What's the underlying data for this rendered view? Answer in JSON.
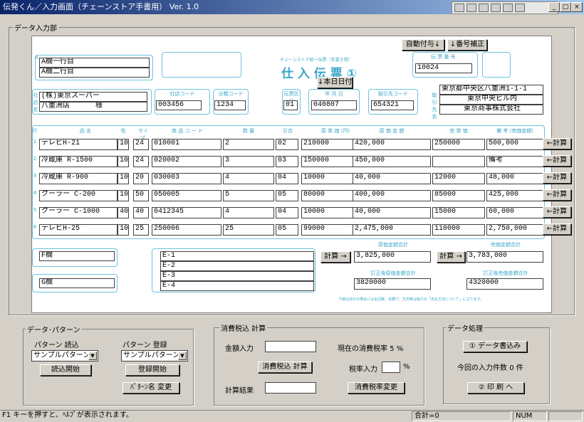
{
  "title": "伝発くん／入力画面（チェーンストア手書用） Ver. 1.0",
  "status": {
    "help": "F1 キーを押すと、ﾍﾙﾌﾟが表示されます。",
    "total": "合計=0",
    "num": "NUM"
  },
  "data_group": "データ入力部",
  "buttons": {
    "auto_num": "自動付与↓",
    "num_fix": "↓番号補正",
    "today": "↓本日日付",
    "calc": "←計算",
    "calc_right": "計算 →"
  },
  "form": {
    "title": "仕 入 伝 票 ①",
    "subtitle": "チェーンストア統一伝票（手書き用）",
    "a1": "A欄一行目",
    "a2": "A欄二行目",
    "slip_label": "伝 票 番 号",
    "slip_no": "10024",
    "store1": "(株)東京スーパー",
    "store2": "八重洲店",
    "store_sama": "様",
    "store_label": "社店名",
    "shop_code_label": "社店コード",
    "shop_code": "003456",
    "class_code_label": "分類コード",
    "class_code": "1234",
    "type_label": "伝票区分",
    "type": "01",
    "date_label": "年 月 日",
    "date": "040807",
    "sup_code_label": "取引先コード",
    "sup_code": "654321",
    "sup1": "東京都中央区八重洲1-1-1",
    "sup2": "東京中央ビル内",
    "sup3": "東京商事株式会社",
    "sup_label": "取引先名",
    "cols": [
      "行",
      "品 名",
      "色",
      "サイズ",
      "商 品 コ ー ド",
      "数 量",
      "引合",
      "原 単 価 (円)",
      "原 価 金 額",
      "売 単 価",
      "備 考 (売価金額)"
    ],
    "rows": [
      {
        "n": "1",
        "name": "テレビH-21",
        "c": "10",
        "s": "24",
        "code": "010001",
        "qty": "2",
        "hk": "02",
        "unit": "210000",
        "amt": "420,000",
        "price": "250000",
        "note": "500,000"
      },
      {
        "n": "2",
        "name": "冷蔵庫 R-1500",
        "c": "10",
        "s": "24",
        "code": "020002",
        "qty": "3",
        "hk": "03",
        "unit": "150000",
        "amt": "450,000",
        "price": "",
        "note": "備考"
      },
      {
        "n": "3",
        "name": "冷蔵庫 R-900",
        "c": "10",
        "s": "20",
        "code": "030003",
        "qty": "4",
        "hk": "04",
        "unit": "10000",
        "amt": "40,000",
        "price": "12000",
        "note": "48,000"
      },
      {
        "n": "4",
        "name": "クーラー C-200",
        "c": "10",
        "s": "50",
        "code": "050005",
        "qty": "5",
        "hk": "05",
        "unit": "80000",
        "amt": "400,000",
        "price": "85000",
        "note": "425,000"
      },
      {
        "n": "5",
        "name": "クーラー C-1000",
        "c": "40",
        "s": "40",
        "code": "0412345",
        "qty": "4",
        "hk": "04",
        "unit": "10000",
        "amt": "40,000",
        "price": "15000",
        "note": "60,000"
      },
      {
        "n": "6",
        "name": "テレビH-25",
        "c": "10",
        "s": "25",
        "code": "250006",
        "qty": "25",
        "hk": "05",
        "unit": "99000",
        "amt": "2,475,000",
        "price": "110000",
        "note": "2,750,000"
      }
    ],
    "f": "F欄",
    "g": "G欄",
    "e": [
      "E-1",
      "E-2",
      "E-3",
      "E-4"
    ],
    "cost_total_label": "原価金額合計",
    "cost_total": "3,825,000",
    "sale_total_label": "売価金額合計",
    "sale_total": "3,783,000",
    "cost_fix_label": "訂正後原価金額合計",
    "cost_fix": "3820000",
    "sale_fix_label": "訂正後売価金額合計",
    "sale_fix": "4320000",
    "footnote": "下線は自分の場合には全記載、全欄で、方法等は後行の「支払方法について」によります。"
  },
  "pattern": {
    "group": "データ･パターン",
    "read_label": "パターン 読込",
    "reg_label": "パターン 登録",
    "read_sel": "サンプルパターン",
    "reg_sel": "サンプルパターン",
    "read_btn": "読込開始",
    "reg_btn": "登録開始",
    "rename_btn": "ﾊﾟﾀｰﾝ名 変更"
  },
  "tax": {
    "group": "消費税込 計算",
    "amount_label": "金額入力",
    "current_label": "現在の消費税率",
    "current": "5 %",
    "calc_btn": "消費税込 計算",
    "rate_label": "税率入力",
    "pct": "%",
    "result_label": "計算結果",
    "change_btn": "消費税率変更"
  },
  "proc": {
    "group": "データ処理",
    "write_btn": "① データ書込み",
    "count_label": "今回の入力件数",
    "count": "0 件",
    "print_btn": "② 印 刷 へ"
  }
}
